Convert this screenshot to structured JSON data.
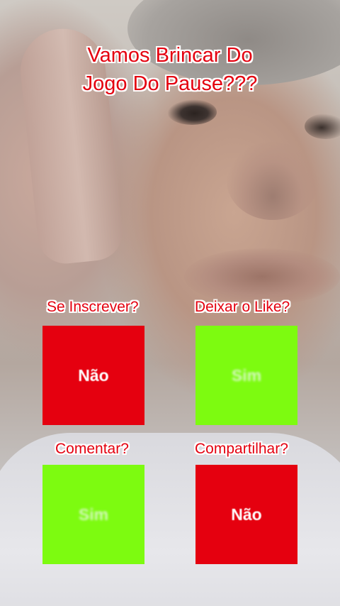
{
  "title": {
    "line1": "Vamos Brincar Do",
    "line2": "Jogo Do Pause???"
  },
  "colors": {
    "text_red": "#e4000f",
    "outline": "#ffffff",
    "box_red": "#e5000f",
    "box_green": "#7dfb10"
  },
  "options": [
    {
      "label": "Se Inscrever?",
      "answer": "Não",
      "color": "red"
    },
    {
      "label": "Deixar o Like?",
      "answer": "Sim",
      "color": "green"
    },
    {
      "label": "Comentar?",
      "answer": "Sim",
      "color": "green"
    },
    {
      "label": "Compartilhar?",
      "answer": "Não",
      "color": "red"
    }
  ]
}
